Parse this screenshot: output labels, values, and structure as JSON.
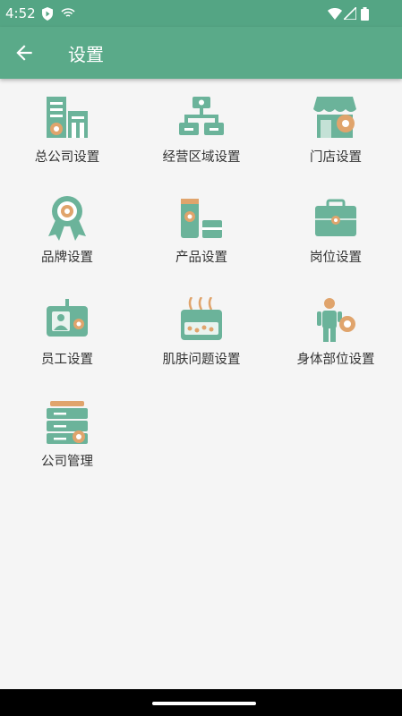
{
  "status": {
    "time": "4:52",
    "icons": [
      "shield-play-icon",
      "wifi-off-icon",
      "wifi-icon",
      "signal-icon",
      "battery-icon"
    ]
  },
  "appbar": {
    "title": "设置",
    "back_icon": "arrow-back-icon"
  },
  "colors": {
    "primary": "#5aaa89",
    "icon_green": "#6bb39a",
    "icon_orange": "#e0a46c"
  },
  "items": [
    {
      "label": "总公司设置",
      "icon": "building-gear-icon"
    },
    {
      "label": "经营区域设置",
      "icon": "hierarchy-icon"
    },
    {
      "label": "门店设置",
      "icon": "store-gear-icon"
    },
    {
      "label": "品牌设置",
      "icon": "badge-ribbon-icon"
    },
    {
      "label": "产品设置",
      "icon": "product-tube-icon"
    },
    {
      "label": "岗位设置",
      "icon": "briefcase-icon"
    },
    {
      "label": "员工设置",
      "icon": "employee-id-card-icon"
    },
    {
      "label": "肌肤问题设置",
      "icon": "skin-layer-icon"
    },
    {
      "label": "身体部位设置",
      "icon": "body-gear-icon"
    },
    {
      "label": "公司管理",
      "icon": "cabinet-gear-icon"
    }
  ]
}
